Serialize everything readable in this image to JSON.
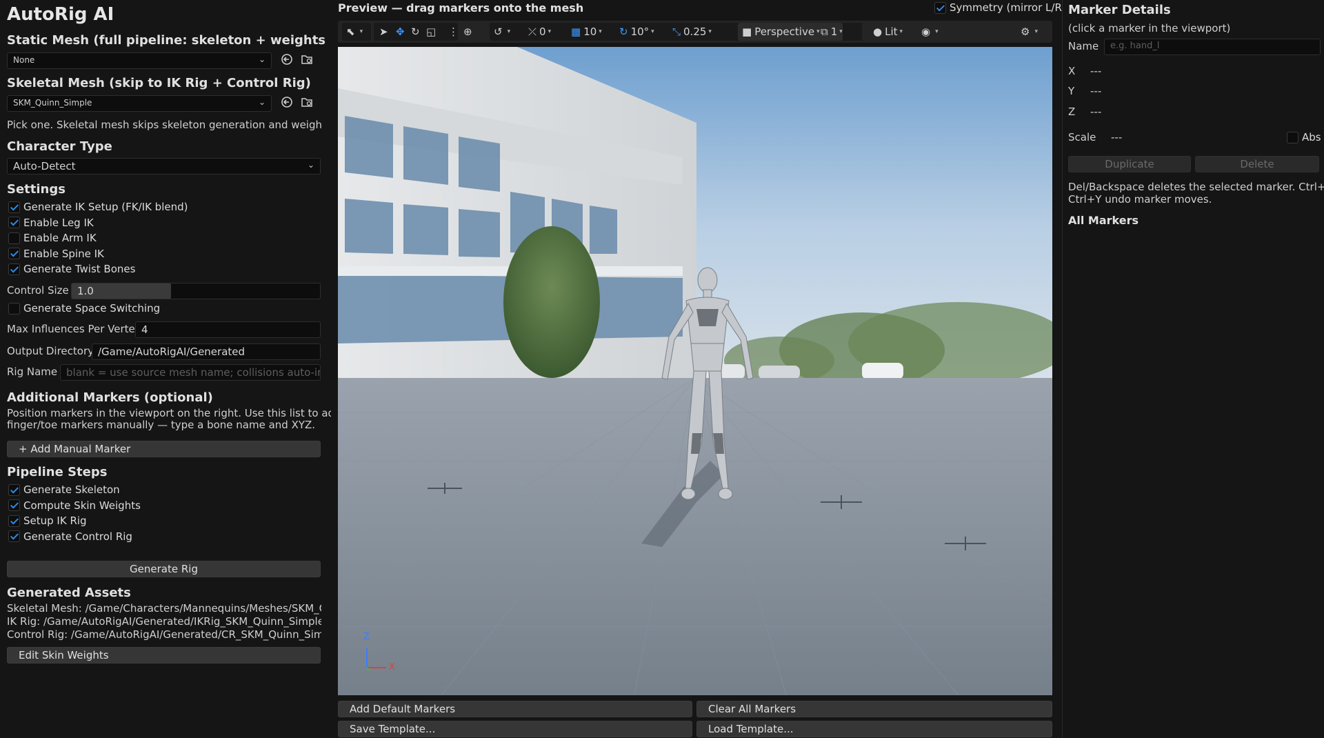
{
  "app_title": "AutoRig AI",
  "static_mesh": {
    "heading": "Static Mesh (full pipeline: skeleton + weights + rig)",
    "value": "None"
  },
  "skeletal_mesh": {
    "heading": "Skeletal Mesh (skip to IK Rig + Control Rig)",
    "value": "SKM_Quinn_Simple",
    "note": "Pick one. Skeletal mesh skips skeleton generation and weight painting."
  },
  "character_type": {
    "heading": "Character Type",
    "value": "Auto-Detect"
  },
  "settings": {
    "heading": "Settings",
    "checkboxes": [
      {
        "label": "Generate IK Setup (FK/IK blend)",
        "checked": true
      },
      {
        "label": "Enable Leg IK",
        "checked": true
      },
      {
        "label": "Enable Arm IK",
        "checked": false
      },
      {
        "label": "Enable Spine IK",
        "checked": true
      },
      {
        "label": "Generate Twist Bones",
        "checked": true
      }
    ],
    "control_size_label": "Control Size",
    "control_size_value": "1.0",
    "control_size_fraction": 0.4,
    "space_switching_label": "Generate Space Switching",
    "space_switching_checked": false,
    "max_influences_label": "Max Influences Per Vertex",
    "max_influences_value": "4",
    "output_dir_label": "Output Directory",
    "output_dir_value": "/Game/AutoRigAI/Generated",
    "rig_name_label": "Rig Name",
    "rig_name_placeholder": "blank = use source mesh name; collisions auto-increment"
  },
  "additional_markers": {
    "heading": "Additional Markers (optional)",
    "desc_line1": "Position markers in the viewport on the right. Use this list to add",
    "desc_line2": "finger/toe markers manually — type a bone name and XYZ.",
    "add_button": "+ Add Manual Marker"
  },
  "pipeline": {
    "heading": "Pipeline Steps",
    "steps": [
      {
        "label": "Generate Skeleton",
        "checked": true
      },
      {
        "label": "Compute Skin Weights",
        "checked": true
      },
      {
        "label": "Setup IK Rig",
        "checked": true
      },
      {
        "label": "Generate Control Rig",
        "checked": true
      }
    ],
    "generate_button": "Generate Rig"
  },
  "generated_assets": {
    "heading": "Generated Assets",
    "skeletal_mesh": "Skeletal Mesh: /Game/Characters/Mannequins/Meshes/SKM_Quinn_Simple",
    "ik_rig": "IK Rig: /Game/AutoRigAI/Generated/IKRig_SKM_Quinn_Simple",
    "control_rig": "Control Rig: /Game/AutoRigAI/Generated/CR_SKM_Quinn_Simple",
    "edit_button": "Edit Skin Weights"
  },
  "preview": {
    "title": "Preview — drag markers onto the mesh",
    "symmetry_label": "Symmetry (mirror L/R)",
    "symmetry_checked": true,
    "toolbar": {
      "rotate_snap": "0",
      "grid": "10",
      "angle": "10°",
      "scale": "0.25",
      "view_mode": "Perspective",
      "layout": "1",
      "lighting": "Lit"
    },
    "axis_z": "Z",
    "axis_x": "X",
    "add_default": "Add Default Markers",
    "clear_all": "Clear All Markers",
    "save_template": "Save Template...",
    "load_template": "Load Template..."
  },
  "marker_details": {
    "title": "Marker Details",
    "subtitle": "(click a marker in the viewport)",
    "name_label": "Name",
    "name_placeholder": "e.g. hand_l",
    "x_label": "X",
    "x_value": "---",
    "y_label": "Y",
    "y_value": "---",
    "z_label": "Z",
    "z_value": "---",
    "scale_label": "Scale",
    "scale_value": "---",
    "abs_label": "Abs",
    "duplicate": "Duplicate",
    "delete": "Delete",
    "help_line1": "Del/Backspace deletes the selected marker. Ctrl+Z/",
    "help_line2": "Ctrl+Y undo marker moves.",
    "all_markers": "All Markers"
  },
  "colors": {
    "accent": "#2e8ae6",
    "panel_bg": "#151515",
    "button_bg": "#363636"
  }
}
